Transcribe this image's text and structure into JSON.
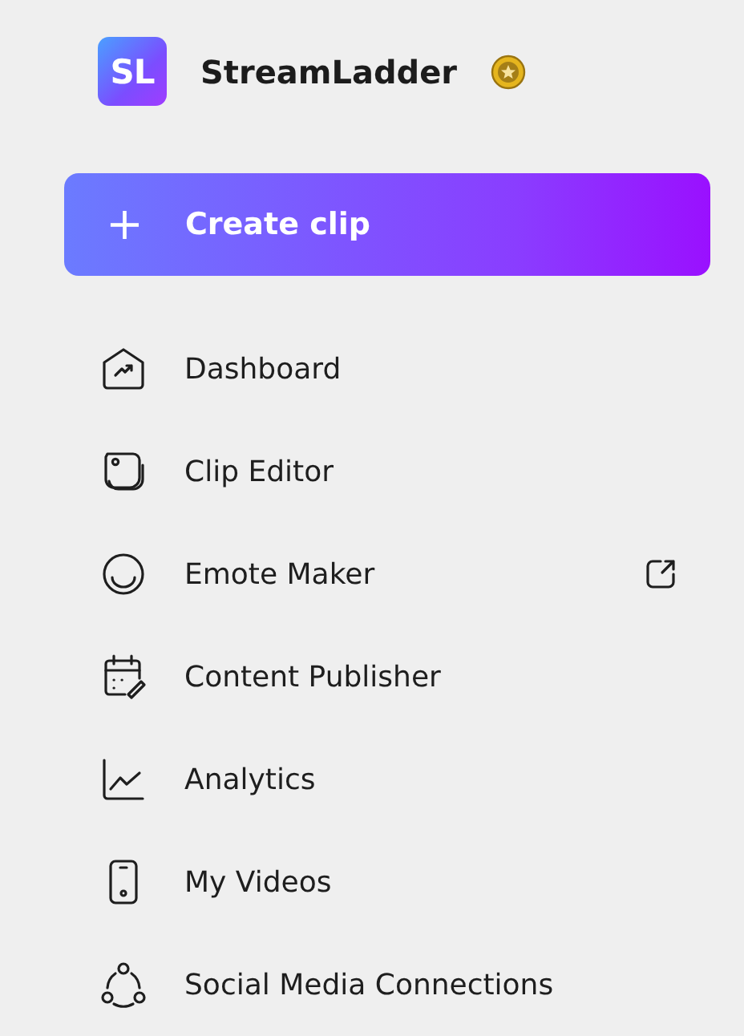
{
  "brand": {
    "logo": "SL",
    "name": "StreamLadder"
  },
  "create_button": {
    "label": "Create clip",
    "icon": "+"
  },
  "nav": [
    {
      "label": "Dashboard",
      "external": false
    },
    {
      "label": "Clip Editor",
      "external": false
    },
    {
      "label": "Emote Maker",
      "external": true
    },
    {
      "label": "Content Publisher",
      "external": false
    },
    {
      "label": "Analytics",
      "external": false
    },
    {
      "label": "My Videos",
      "external": false
    },
    {
      "label": "Social Media Connections",
      "external": false
    }
  ]
}
